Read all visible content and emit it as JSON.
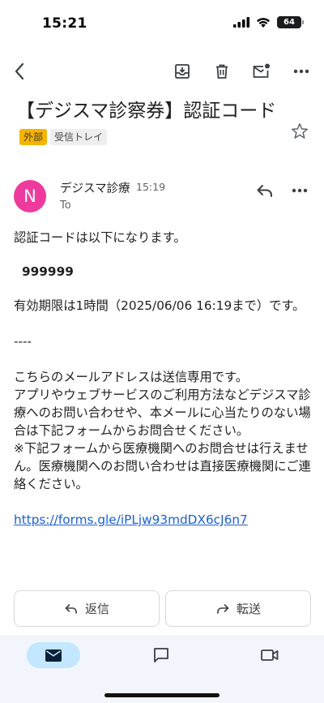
{
  "status_bar": {
    "time": "15:21",
    "battery": "64"
  },
  "toolbar": {
    "icons": [
      "back-arrow-icon",
      "archive-icon",
      "trash-icon",
      "mark-unread-icon",
      "more-horizontal-icon"
    ]
  },
  "email": {
    "subject": "【デジスマ診察券】認証コード",
    "labels": [
      "外部",
      "受信トレイ"
    ],
    "sender": {
      "initial": "N",
      "name": "デジスマ診療",
      "time": "15:19",
      "to": "To"
    },
    "body": {
      "intro": "認証コードは以下になります。",
      "code": "999999",
      "expiry": "有効期限は1時間（2025/06/06 16:19まで）です。",
      "separator": "----",
      "notice_1": "こちらのメールアドレスは送信専用です。",
      "notice_2": "アプリやウェブサービスのご利用方法などデジスマ診療へのお問い合わせや、本メールに心当たりのない場合は下記フォームからお問合せください。",
      "notice_3": "※下記フォームから医療機関へのお問合せは行えません。医療機関へのお問い合わせは直接医療機関にご連絡ください。",
      "link": "https://forms.gle/iPLjw93mdDX6cJ6n7"
    }
  },
  "actions": {
    "reply": "返信",
    "forward": "転送"
  },
  "colors": {
    "avatar": "#ee3a9c",
    "external_chip": "#f4b400",
    "link": "#1a5fd6",
    "nav_active": "#c2e7ff"
  }
}
